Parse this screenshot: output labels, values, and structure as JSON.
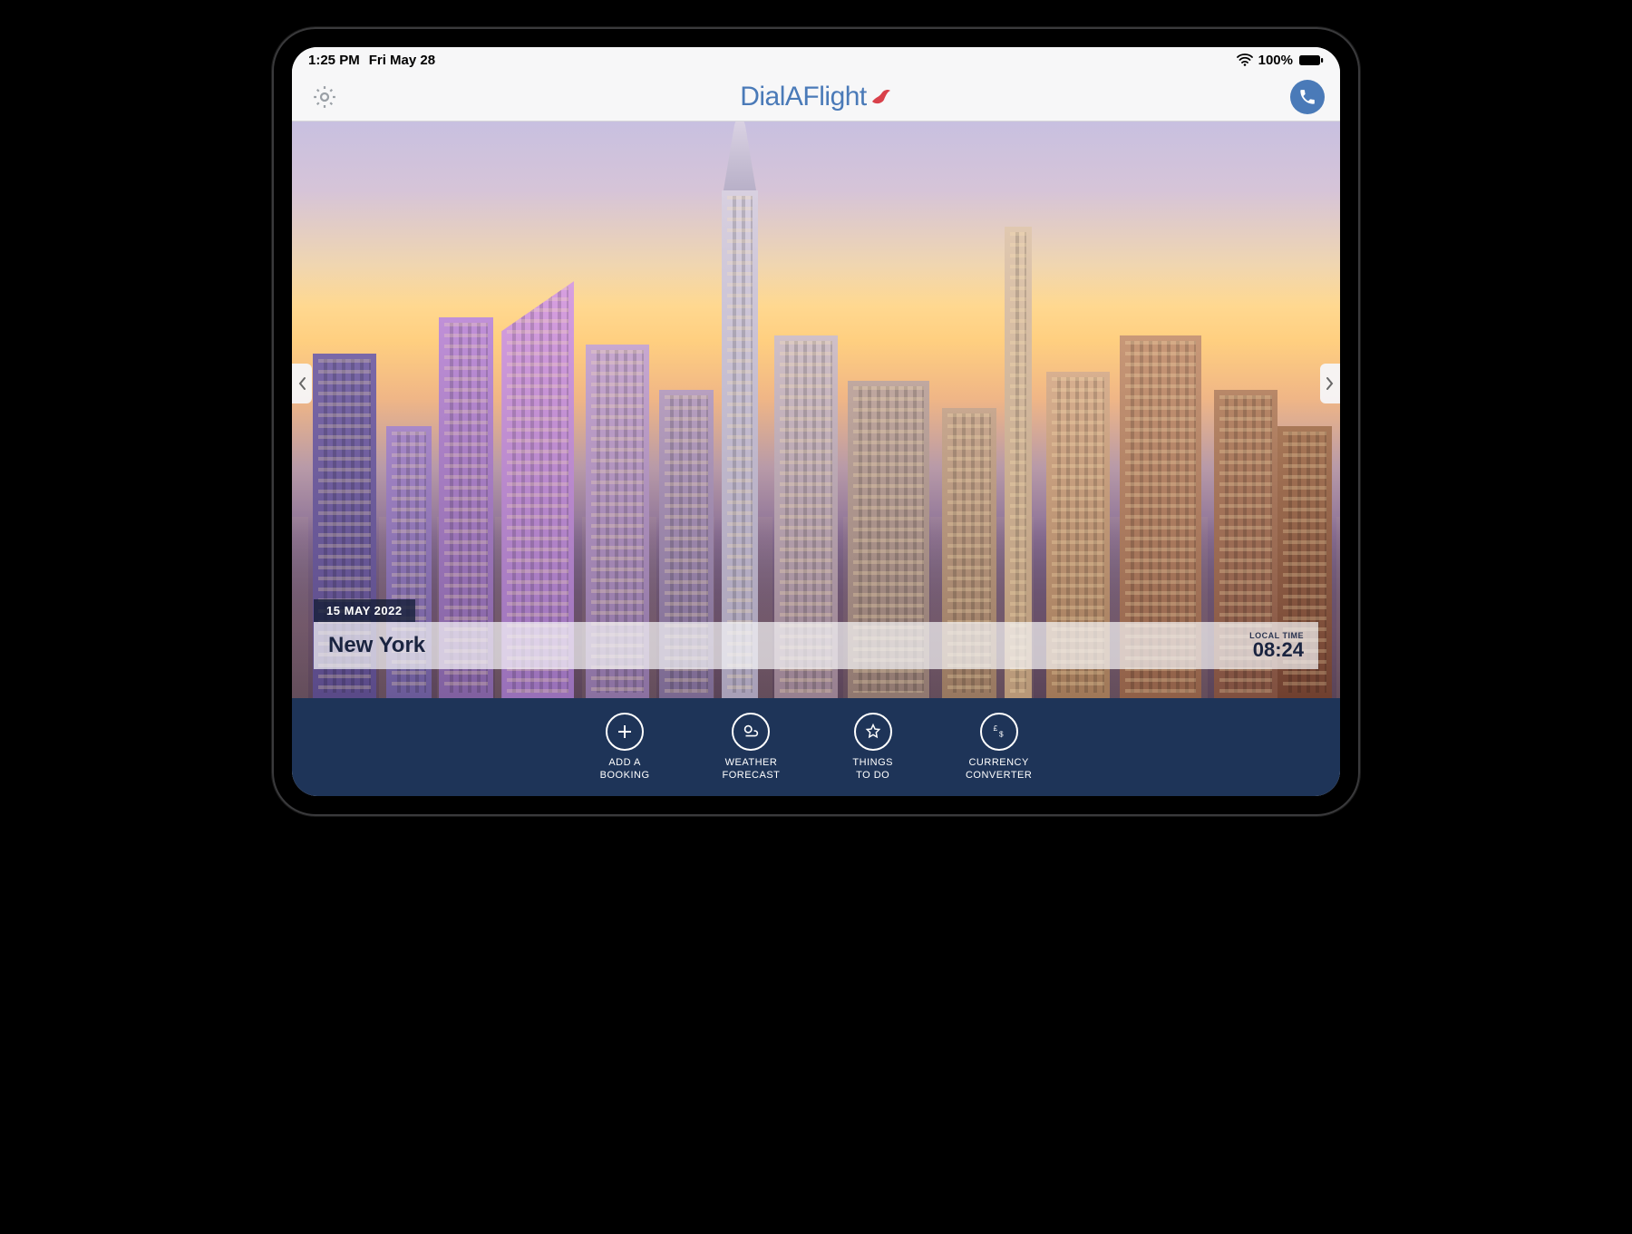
{
  "status": {
    "time": "1:25 PM",
    "date": "Fri May 28",
    "battery": "100%"
  },
  "header": {
    "app_name": "DialAFlight"
  },
  "destination": {
    "trip_date": "15 MAY 2022",
    "city": "New York",
    "local_time_label": "LOCAL TIME",
    "local_time": "08:24"
  },
  "toolbar": {
    "add_booking": "ADD A\nBOOKING",
    "weather": "WEATHER\nFORECAST",
    "things": "THINGS\nTO DO",
    "currency": "CURRENCY\nCONVERTER"
  }
}
